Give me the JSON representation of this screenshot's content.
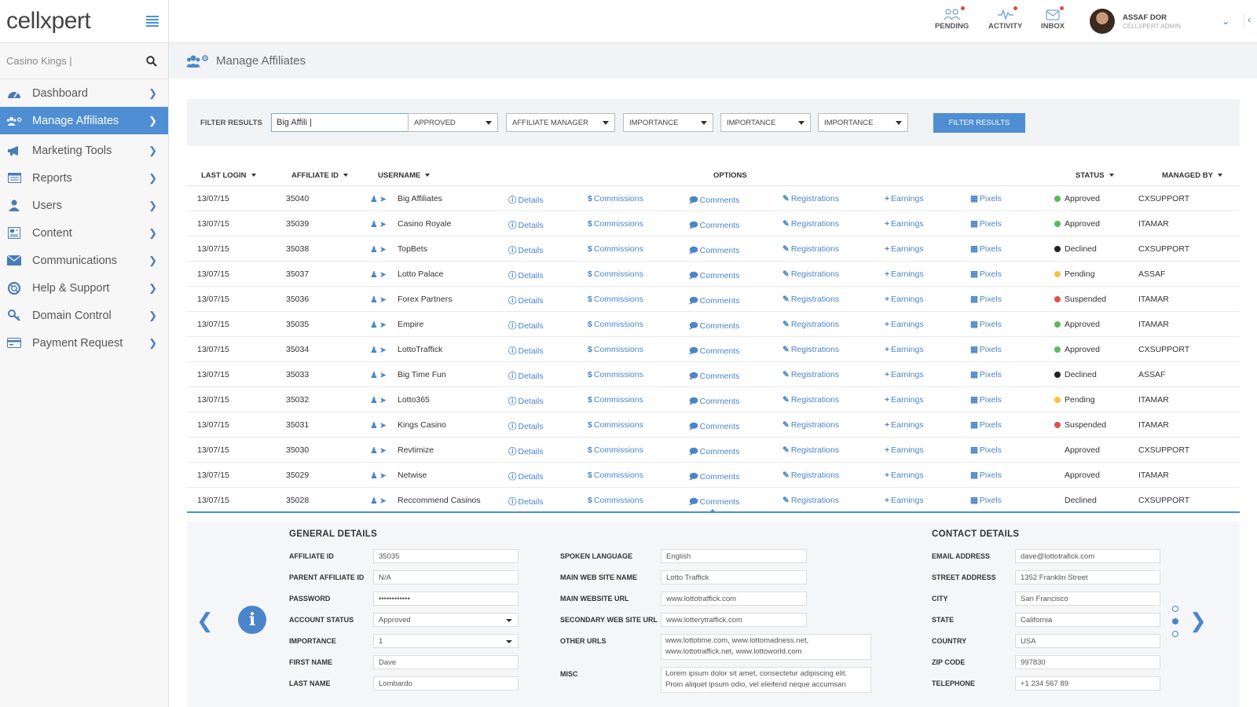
{
  "app": {
    "logo": "cellxpert"
  },
  "sidebar": {
    "search_value": "Casino Kings |",
    "items": [
      {
        "label": "Dashboard",
        "icon": "dashboard-icon"
      },
      {
        "label": "Manage Affiliates",
        "icon": "affiliates-icon",
        "active": true
      },
      {
        "label": "Marketing Tools",
        "icon": "megaphone-icon"
      },
      {
        "label": "Reports",
        "icon": "reports-icon"
      },
      {
        "label": "Users",
        "icon": "user-icon"
      },
      {
        "label": "Content",
        "icon": "content-icon"
      },
      {
        "label": "Communications",
        "icon": "envelope-icon"
      },
      {
        "label": "Help & Support",
        "icon": "lifebuoy-icon"
      },
      {
        "label": "Domain Control",
        "icon": "key-icon"
      },
      {
        "label": "Payment Request",
        "icon": "credit-card-icon"
      }
    ]
  },
  "header": {
    "pending": "PENDING",
    "activity": "ACTIVITY",
    "inbox": "INBOX",
    "user_name": "ASSAF DOR",
    "user_role": "CELLXPERT ADMIN"
  },
  "page": {
    "title": "Manage Affiliates"
  },
  "filters": {
    "label": "FILTER RESULTS",
    "search_value": "Big Affili |",
    "status": "APPROVED",
    "manager": "AFFILIATE MANAGER",
    "importance_1": "IMPORTANCE",
    "importance_2": "IMPORTANCE",
    "importance_3": "IMPORTANCE",
    "button": "FILTER RESULTS"
  },
  "table": {
    "headers": {
      "last_login": "LAST LOGIN",
      "affiliate_id": "AFFILIATE ID",
      "username": "USERNAME",
      "options": "OPTIONS",
      "status": "STATUS",
      "managed_by": "MANAGED BY"
    },
    "option_labels": {
      "details": "Details",
      "commissions": "Commissions",
      "comments": "Comments",
      "registrations": "Registrations",
      "earnings": "Earnings",
      "pixels": "Pixels"
    },
    "status_colors": {
      "Approved": "#5cb85c",
      "Declined": "#222222",
      "Pending": "#f5c242",
      "Suspended": "#d9534f"
    },
    "rows": [
      {
        "last_login": "13/07/15",
        "id": "35040",
        "username": "Big Affiliates",
        "status": "Approved",
        "dot": true,
        "managed_by": "CXSUPPORT"
      },
      {
        "last_login": "13/07/15",
        "id": "35039",
        "username": "Casino Royale",
        "status": "Approved",
        "dot": true,
        "managed_by": "ITAMAR"
      },
      {
        "last_login": "13/07/15",
        "id": "35038",
        "username": "TopBets",
        "status": "Declined",
        "dot": true,
        "managed_by": "CXSUPPORT"
      },
      {
        "last_login": "13/07/15",
        "id": "35037",
        "username": "Lotto Palace",
        "status": "Pending",
        "dot": true,
        "managed_by": "ASSAF"
      },
      {
        "last_login": "13/07/15",
        "id": "35036",
        "username": "Forex Partners",
        "status": "Suspended",
        "dot": true,
        "managed_by": "ITAMAR"
      },
      {
        "last_login": "13/07/15",
        "id": "35035",
        "username": "Empire",
        "status": "Approved",
        "dot": true,
        "managed_by": "ITAMAR"
      },
      {
        "last_login": "13/07/15",
        "id": "35034",
        "username": "LottoTraffick",
        "status": "Approved",
        "dot": true,
        "managed_by": "CXSUPPORT"
      },
      {
        "last_login": "13/07/15",
        "id": "35033",
        "username": "Big Time Fun",
        "status": "Declined",
        "dot": true,
        "managed_by": "ASSAF"
      },
      {
        "last_login": "13/07/15",
        "id": "35032",
        "username": "Lotto365",
        "status": "Pending",
        "dot": true,
        "managed_by": "ITAMAR"
      },
      {
        "last_login": "13/07/15",
        "id": "35031",
        "username": "Kings Casino",
        "status": "Suspended",
        "dot": true,
        "managed_by": "ITAMAR"
      },
      {
        "last_login": "13/07/15",
        "id": "35030",
        "username": "Revtimize",
        "status": "Approved",
        "dot": false,
        "managed_by": "CXSUPPORT"
      },
      {
        "last_login": "13/07/15",
        "id": "35029",
        "username": "Netwise",
        "status": "Approved",
        "dot": false,
        "managed_by": "ITAMAR"
      },
      {
        "last_login": "13/07/15",
        "id": "35028",
        "username": "Reccommend Casinos",
        "status": "Declined",
        "dot": false,
        "managed_by": "CXSUPPORT"
      }
    ]
  },
  "details": {
    "general_title": "GENERAL DETAILS",
    "contact_title": "CONTACT DETAILS",
    "general": [
      {
        "label": "AFFILIATE ID",
        "value": "35035"
      },
      {
        "label": "PARENT AFFILIATE ID",
        "value": "N/A"
      },
      {
        "label": "PASSWORD",
        "value": "••••••••••••"
      },
      {
        "label": "ACCOUNT STATUS",
        "value": "Approved",
        "select": true
      },
      {
        "label": "IMPORTANCE",
        "value": "1",
        "select": true
      },
      {
        "label": "FIRST NAME",
        "value": "Dave"
      },
      {
        "label": "LAST NAME",
        "value": "Lombardo"
      }
    ],
    "middle": [
      {
        "label": "SPOKEN LANGUAGE",
        "value": "English"
      },
      {
        "label": "MAIN WEB SITE NAME",
        "value": "Lotto Traffick"
      },
      {
        "label": "MAIN WEBSITE URL",
        "value": "www.lottotraffick.com"
      },
      {
        "label": "SECONDARY WEB SITE URL",
        "value": "www.lotterytraffick.com"
      },
      {
        "label": "OTHER URLS",
        "value": "www.lottotime.com, www.lottomadness.net, www.lottotraffick.net, www.lottoworld.com"
      },
      {
        "label": "MISC",
        "value": "Lorem ipsum dolor sit amet, consectetur adipiscing elit. Proin aliquet ipsum odio, vel eleifend neque accumsan"
      }
    ],
    "contact": [
      {
        "label": "EMAIL ADDRESS",
        "value": "dave@lottotrafick.com"
      },
      {
        "label": "STREET ADDRESS",
        "value": "1352 Franklin Street"
      },
      {
        "label": "CITY",
        "value": "San Francisco"
      },
      {
        "label": "STATE",
        "value": "California"
      },
      {
        "label": "COUNTRY",
        "value": "USA"
      },
      {
        "label": "ZIP CODE",
        "value": "997830"
      },
      {
        "label": "TELEPHONE",
        "value": "+1 234 567 89"
      }
    ]
  }
}
